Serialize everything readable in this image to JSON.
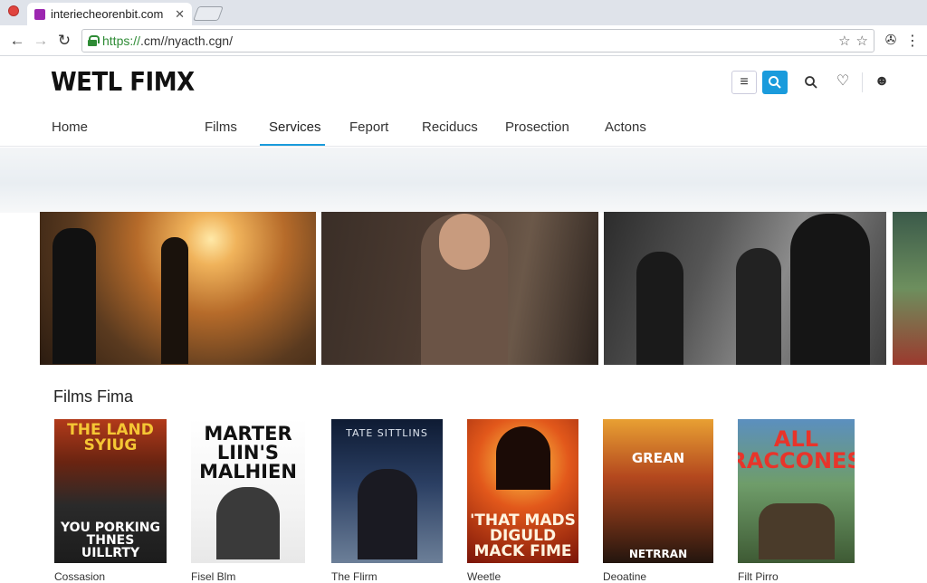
{
  "browser": {
    "tab_title": "interiecheorenbit.com",
    "tab_close": "✕",
    "url_scheme": "https://",
    "url_rest": ".cm//nyacth.cgn/"
  },
  "site": {
    "logo": "WETL FIMX",
    "nav": [
      "Home",
      "Films",
      "Services",
      "Feport",
      "Reciducs",
      "Prosection",
      "Actons"
    ],
    "active_nav": "Services"
  },
  "section": {
    "title": "Films Fima"
  },
  "posters": [
    {
      "top": "THE LAND SYIUG",
      "bottom": "YOU PORKING THNES UILLRTY",
      "caption": "Cossasion"
    },
    {
      "top": "MARTER LIIN'S MALHIEN",
      "bottom": "",
      "caption": "Fisel Blm"
    },
    {
      "top": "TATE SITTLINS",
      "bottom": "",
      "caption": "The Flirm"
    },
    {
      "top": "",
      "bottom": "'THAT MADS DIGULD MACK FIME",
      "caption": "Weetle"
    },
    {
      "top": "GREAN",
      "bottom": "NETRRAN",
      "caption": "Deoatine"
    },
    {
      "top": "ALL RACCONES",
      "bottom": "",
      "caption": "Filt Pirro"
    }
  ],
  "colors": {
    "accent": "#1a9bdc",
    "secure_green": "#2e8b35"
  }
}
